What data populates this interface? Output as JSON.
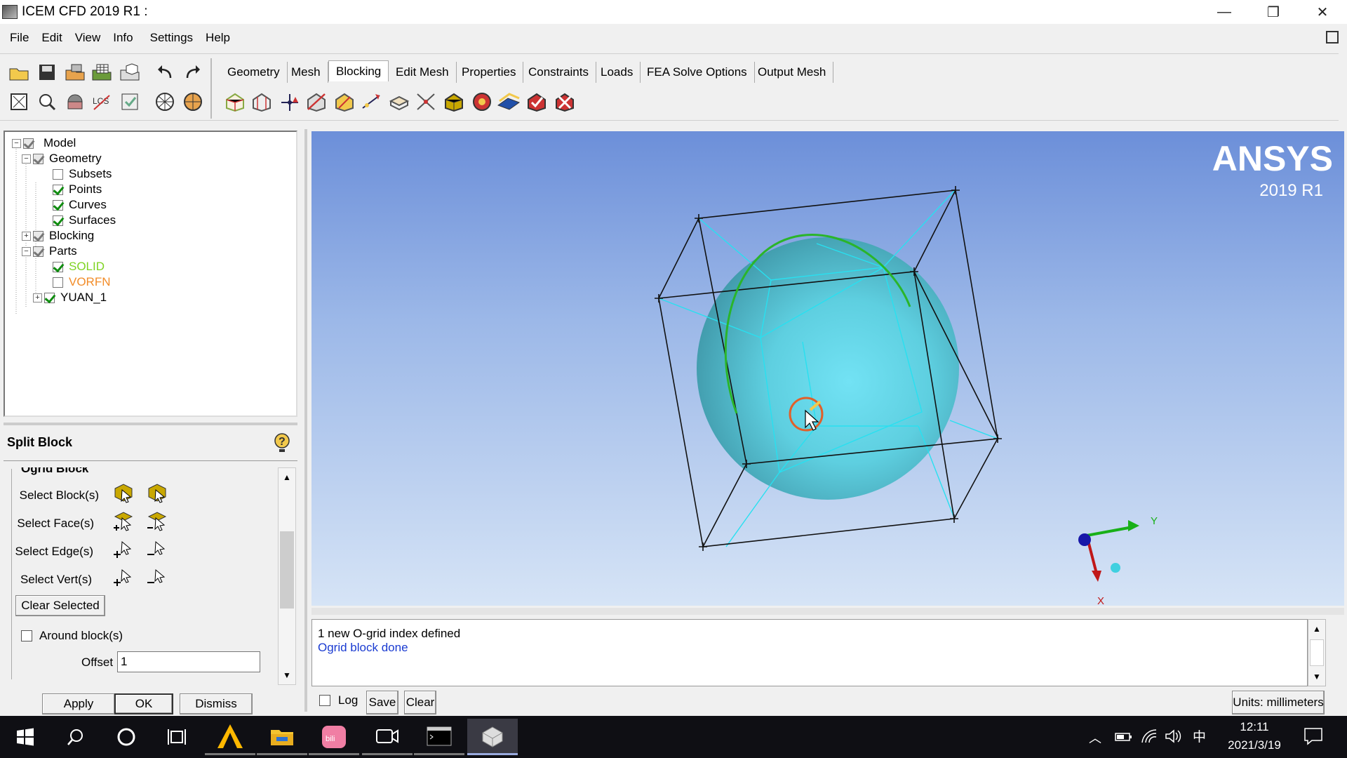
{
  "window": {
    "title": "ICEM CFD 2019 R1 :"
  },
  "menu": [
    "File",
    "Edit",
    "View",
    "Info",
    "Settings",
    "Help"
  ],
  "tabs": [
    {
      "label": "Geometry"
    },
    {
      "label": "Mesh"
    },
    {
      "label": "Blocking",
      "active": true
    },
    {
      "label": "Edit Mesh"
    },
    {
      "label": "Properties"
    },
    {
      "label": "Constraints"
    },
    {
      "label": "Loads"
    },
    {
      "label": "FEA Solve Options"
    },
    {
      "label": "Output Mesh"
    }
  ],
  "tree": [
    {
      "label": "Model",
      "checked": true,
      "expander": "−",
      "color": "#000"
    },
    {
      "label": "Geometry",
      "checked": true,
      "expander": "−",
      "color": "#000"
    },
    {
      "label": "Subsets",
      "checked": false,
      "color": "#000"
    },
    {
      "label": "Points",
      "checked": true,
      "color": "#000"
    },
    {
      "label": "Curves",
      "checked": true,
      "color": "#000"
    },
    {
      "label": "Surfaces",
      "checked": true,
      "color": "#000"
    },
    {
      "label": "Blocking",
      "checked": true,
      "expander": "+",
      "color": "#000"
    },
    {
      "label": "Parts",
      "checked": true,
      "expander": "−",
      "color": "#000"
    },
    {
      "label": "SOLID",
      "checked": true,
      "color": "#7ed321"
    },
    {
      "label": "VORFN",
      "checked": false,
      "color": "#f28c28"
    },
    {
      "label": "YUAN_1",
      "checked": true,
      "expander": "+",
      "color": "#000"
    }
  ],
  "panel": {
    "title": "Split Block",
    "section": "Ogrid Block",
    "select_blocks": "Select Block(s)",
    "select_faces": "Select Face(s)",
    "select_edges": "Select Edge(s)",
    "select_verts": "Select Vert(s)",
    "clear_selected": "Clear Selected",
    "around_blocks": "Around block(s)",
    "offset_label": "Offset",
    "offset_value": "1",
    "apply": "Apply",
    "ok": "OK",
    "dismiss": "Dismiss"
  },
  "viewport": {
    "brand": "ANSYS",
    "version": "2019 R1",
    "axis_y": "Y",
    "axis_x": "X"
  },
  "messages": {
    "line1": "1 new O-grid index defined",
    "line2": "Ogrid block done",
    "log": "Log",
    "save": "Save",
    "clear": "Clear",
    "units": "Units: millimeters"
  },
  "taskbar": {
    "time": "12:11",
    "date": "2021/3/19",
    "ime": "中"
  },
  "colors": {
    "solid_part": "#7ed321",
    "vorfn_part": "#f28c28",
    "message_done": "#1a3bd1"
  }
}
